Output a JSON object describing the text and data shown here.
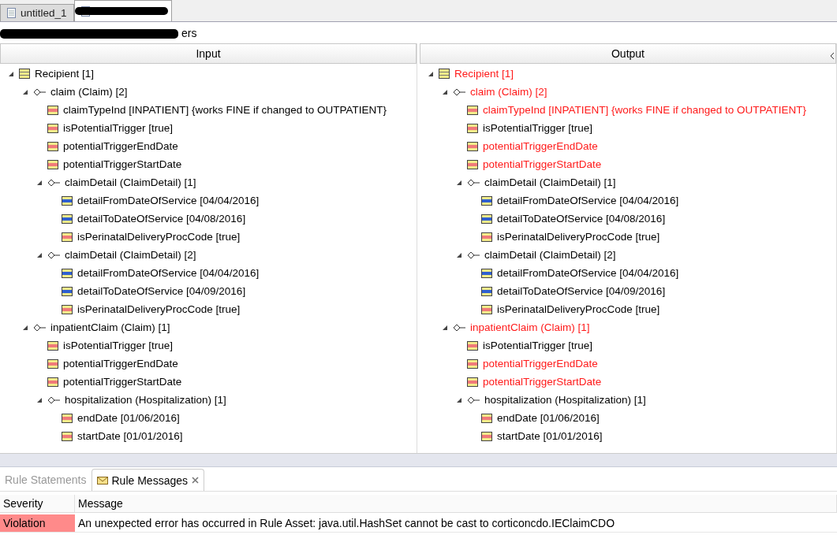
{
  "editor_tabs": [
    {
      "label": "untitled_1",
      "selected": false,
      "redacted": false
    },
    {
      "selected": true,
      "redacted": true
    }
  ],
  "subtitle": {
    "text": "ers",
    "redacted": true
  },
  "panels": [
    {
      "title": "Input",
      "tree": [
        {
          "label": "Recipient [1]",
          "kind": "entity",
          "changed": false,
          "expanded": true,
          "children": [
            {
              "label": "claim (Claim) [2]",
              "kind": "association",
              "changed": false,
              "expanded": true,
              "children": [
                {
                  "label": "claimTypeInd [INPATIENT] {works FINE if changed to OUTPATIENT}",
                  "kind": "attribute",
                  "color": "#f07a7a",
                  "changed": false
                },
                {
                  "label": "isPotentialTrigger [true]",
                  "kind": "attribute",
                  "color": "#f07a7a",
                  "changed": false
                },
                {
                  "label": "potentialTriggerEndDate",
                  "kind": "attribute",
                  "color": "#f07a7a",
                  "changed": false
                },
                {
                  "label": "potentialTriggerStartDate",
                  "kind": "attribute",
                  "color": "#f07a7a",
                  "changed": false
                },
                {
                  "label": "claimDetail (ClaimDetail) [1]",
                  "kind": "association",
                  "changed": false,
                  "expanded": true,
                  "children": [
                    {
                      "label": "detailFromDateOfService [04/04/2016]",
                      "kind": "attribute",
                      "color": "#2f5fd0",
                      "changed": false
                    },
                    {
                      "label": "detailToDateOfService [04/08/2016]",
                      "kind": "attribute",
                      "color": "#2f5fd0",
                      "changed": false
                    },
                    {
                      "label": "isPerinatalDeliveryProcCode [true]",
                      "kind": "attribute",
                      "color": "#f07a7a",
                      "changed": false
                    }
                  ]
                },
                {
                  "label": "claimDetail (ClaimDetail) [2]",
                  "kind": "association",
                  "changed": false,
                  "expanded": true,
                  "children": [
                    {
                      "label": "detailFromDateOfService [04/04/2016]",
                      "kind": "attribute",
                      "color": "#2f5fd0",
                      "changed": false
                    },
                    {
                      "label": "detailToDateOfService [04/09/2016]",
                      "kind": "attribute",
                      "color": "#2f5fd0",
                      "changed": false
                    },
                    {
                      "label": "isPerinatalDeliveryProcCode [true]",
                      "kind": "attribute",
                      "color": "#f07a7a",
                      "changed": false
                    }
                  ]
                }
              ]
            },
            {
              "label": "inpatientClaim (Claim) [1]",
              "kind": "association",
              "changed": false,
              "expanded": true,
              "children": [
                {
                  "label": "isPotentialTrigger [true]",
                  "kind": "attribute",
                  "color": "#f07a7a",
                  "changed": false
                },
                {
                  "label": "potentialTriggerEndDate",
                  "kind": "attribute",
                  "color": "#f07a7a",
                  "changed": false
                },
                {
                  "label": "potentialTriggerStartDate",
                  "kind": "attribute",
                  "color": "#f07a7a",
                  "changed": false
                },
                {
                  "label": "hospitalization (Hospitalization) [1]",
                  "kind": "association",
                  "changed": false,
                  "expanded": true,
                  "children": [
                    {
                      "label": "endDate [01/06/2016]",
                      "kind": "attribute",
                      "color": "#f07a7a",
                      "changed": false
                    },
                    {
                      "label": "startDate [01/01/2016]",
                      "kind": "attribute",
                      "color": "#f07a7a",
                      "changed": false
                    }
                  ]
                }
              ]
            }
          ]
        }
      ]
    },
    {
      "title": "Output",
      "tree": [
        {
          "label": "Recipient [1]",
          "kind": "entity",
          "changed": true,
          "expanded": true,
          "children": [
            {
              "label": "claim (Claim) [2]",
              "kind": "association",
              "changed": true,
              "expanded": true,
              "children": [
                {
                  "label": "claimTypeInd [INPATIENT] {works FINE if changed to OUTPATIENT}",
                  "kind": "attribute",
                  "color": "#f07a7a",
                  "changed": true
                },
                {
                  "label": "isPotentialTrigger [true]",
                  "kind": "attribute",
                  "color": "#f07a7a",
                  "changed": false
                },
                {
                  "label": "potentialTriggerEndDate",
                  "kind": "attribute",
                  "color": "#f07a7a",
                  "changed": true
                },
                {
                  "label": "potentialTriggerStartDate",
                  "kind": "attribute",
                  "color": "#f07a7a",
                  "changed": true
                },
                {
                  "label": "claimDetail (ClaimDetail) [1]",
                  "kind": "association",
                  "changed": false,
                  "expanded": true,
                  "children": [
                    {
                      "label": "detailFromDateOfService [04/04/2016]",
                      "kind": "attribute",
                      "color": "#2f5fd0",
                      "changed": false
                    },
                    {
                      "label": "detailToDateOfService [04/08/2016]",
                      "kind": "attribute",
                      "color": "#2f5fd0",
                      "changed": false
                    },
                    {
                      "label": "isPerinatalDeliveryProcCode [true]",
                      "kind": "attribute",
                      "color": "#f07a7a",
                      "changed": false
                    }
                  ]
                },
                {
                  "label": "claimDetail (ClaimDetail) [2]",
                  "kind": "association",
                  "changed": false,
                  "expanded": true,
                  "children": [
                    {
                      "label": "detailFromDateOfService [04/04/2016]",
                      "kind": "attribute",
                      "color": "#2f5fd0",
                      "changed": false
                    },
                    {
                      "label": "detailToDateOfService [04/09/2016]",
                      "kind": "attribute",
                      "color": "#2f5fd0",
                      "changed": false
                    },
                    {
                      "label": "isPerinatalDeliveryProcCode [true]",
                      "kind": "attribute",
                      "color": "#f07a7a",
                      "changed": false
                    }
                  ]
                }
              ]
            },
            {
              "label": "inpatientClaim (Claim) [1]",
              "kind": "association",
              "changed": true,
              "expanded": true,
              "children": [
                {
                  "label": "isPotentialTrigger [true]",
                  "kind": "attribute",
                  "color": "#f07a7a",
                  "changed": false
                },
                {
                  "label": "potentialTriggerEndDate",
                  "kind": "attribute",
                  "color": "#f07a7a",
                  "changed": true
                },
                {
                  "label": "potentialTriggerStartDate",
                  "kind": "attribute",
                  "color": "#f07a7a",
                  "changed": true
                },
                {
                  "label": "hospitalization (Hospitalization) [1]",
                  "kind": "association",
                  "changed": false,
                  "expanded": true,
                  "children": [
                    {
                      "label": "endDate [01/06/2016]",
                      "kind": "attribute",
                      "color": "#f07a7a",
                      "changed": false
                    },
                    {
                      "label": "startDate [01/01/2016]",
                      "kind": "attribute",
                      "color": "#f07a7a",
                      "changed": false
                    }
                  ]
                }
              ]
            }
          ]
        }
      ]
    }
  ],
  "bottom_tabs": [
    {
      "label": "Rule Statements",
      "selected": false,
      "closable": false
    },
    {
      "label": "Rule Messages",
      "selected": true,
      "closable": true
    }
  ],
  "messages": {
    "columns": [
      "Severity",
      "Message"
    ],
    "rows": [
      {
        "severity": "Violation",
        "color": "#ff8a8a",
        "message": "An unexpected error has occurred in Rule Asset: java.util.HashSet cannot be cast to corticoncdo.IEClaimCDO"
      }
    ]
  }
}
